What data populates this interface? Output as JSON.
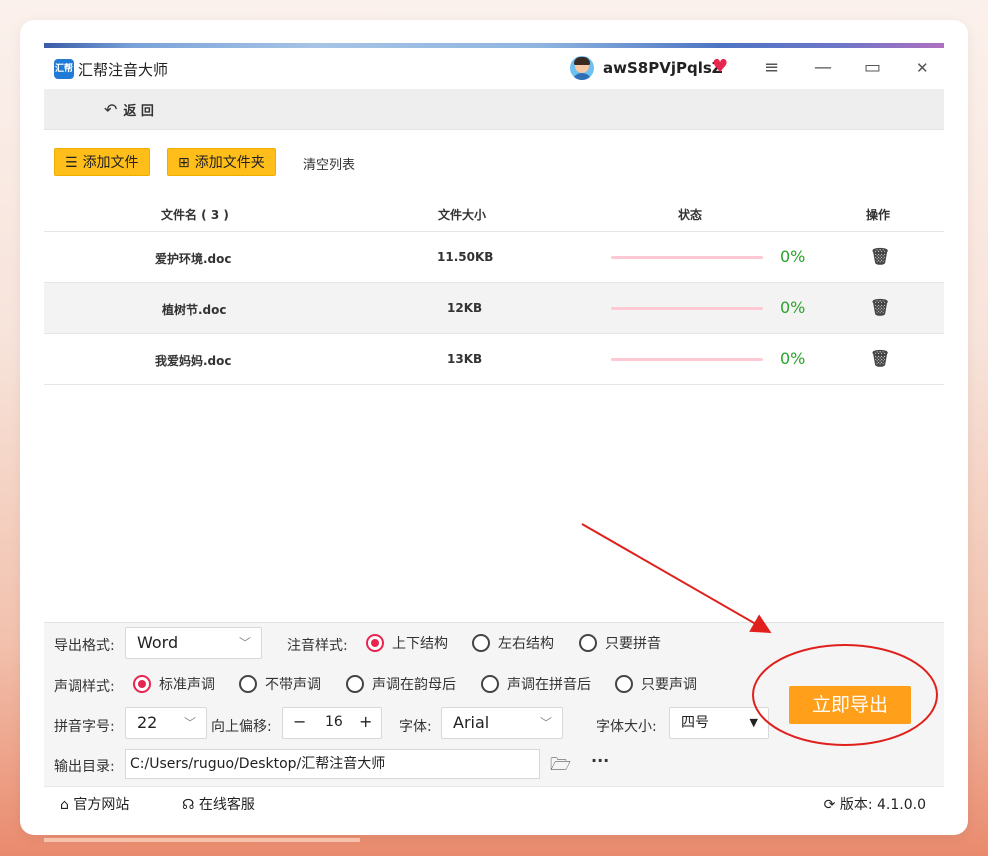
{
  "app": {
    "title": "汇帮注音大师",
    "logo_text": "汇帮",
    "username": "awS8PVjPqlsZ"
  },
  "titlebar": {
    "menu_glyph": "≡",
    "minimize_glyph": "—",
    "maximize_glyph": "▭",
    "close_glyph": "✕"
  },
  "nav": {
    "back_label": "返 回"
  },
  "toolbar": {
    "add_file_label": "添加文件",
    "add_folder_label": "添加文件夹",
    "clear_label": "清空列表"
  },
  "table": {
    "headers": {
      "name": "文件名 ( 3 )",
      "size": "文件大小",
      "status": "状态",
      "action": "操作"
    },
    "rows": [
      {
        "name": "爱护环境.doc",
        "size": "11.50KB",
        "progress_text": "0%"
      },
      {
        "name": "植树节.doc",
        "size": "12KB",
        "progress_text": "0%"
      },
      {
        "name": "我爱妈妈.doc",
        "size": "13KB",
        "progress_text": "0%"
      }
    ]
  },
  "settings": {
    "export_format_label": "导出格式:",
    "export_format_value": "Word",
    "annot_style_label": "注音样式:",
    "annot_options": [
      "上下结构",
      "左右结构",
      "只要拼音"
    ],
    "tone_style_label": "声调样式:",
    "tone_options": [
      "标准声调",
      "不带声调",
      "声调在韵母后",
      "声调在拼音后",
      "只要声调"
    ],
    "pinyin_size_label": "拼音字号:",
    "pinyin_size_value": "22",
    "offset_label": "向上偏移:",
    "offset_value": "16",
    "font_label": "字体:",
    "font_value": "Arial",
    "font_size_label": "字体大小:",
    "font_size_value": "四号",
    "output_dir_label": "输出目录:",
    "output_dir_value": "C:/Users/ruguo/Desktop/汇帮注音大师",
    "export_button": "立即导出"
  },
  "footer": {
    "official_site": "官方网站",
    "online_service": "在线客服",
    "version": "版本: 4.1.0.0"
  },
  "colors": {
    "accent_yellow": "#ffbe1a",
    "export_orange": "#ff9f1a",
    "radio_red": "#e8254e",
    "progress_green": "#29a329",
    "annotation_red": "#e0201c"
  }
}
